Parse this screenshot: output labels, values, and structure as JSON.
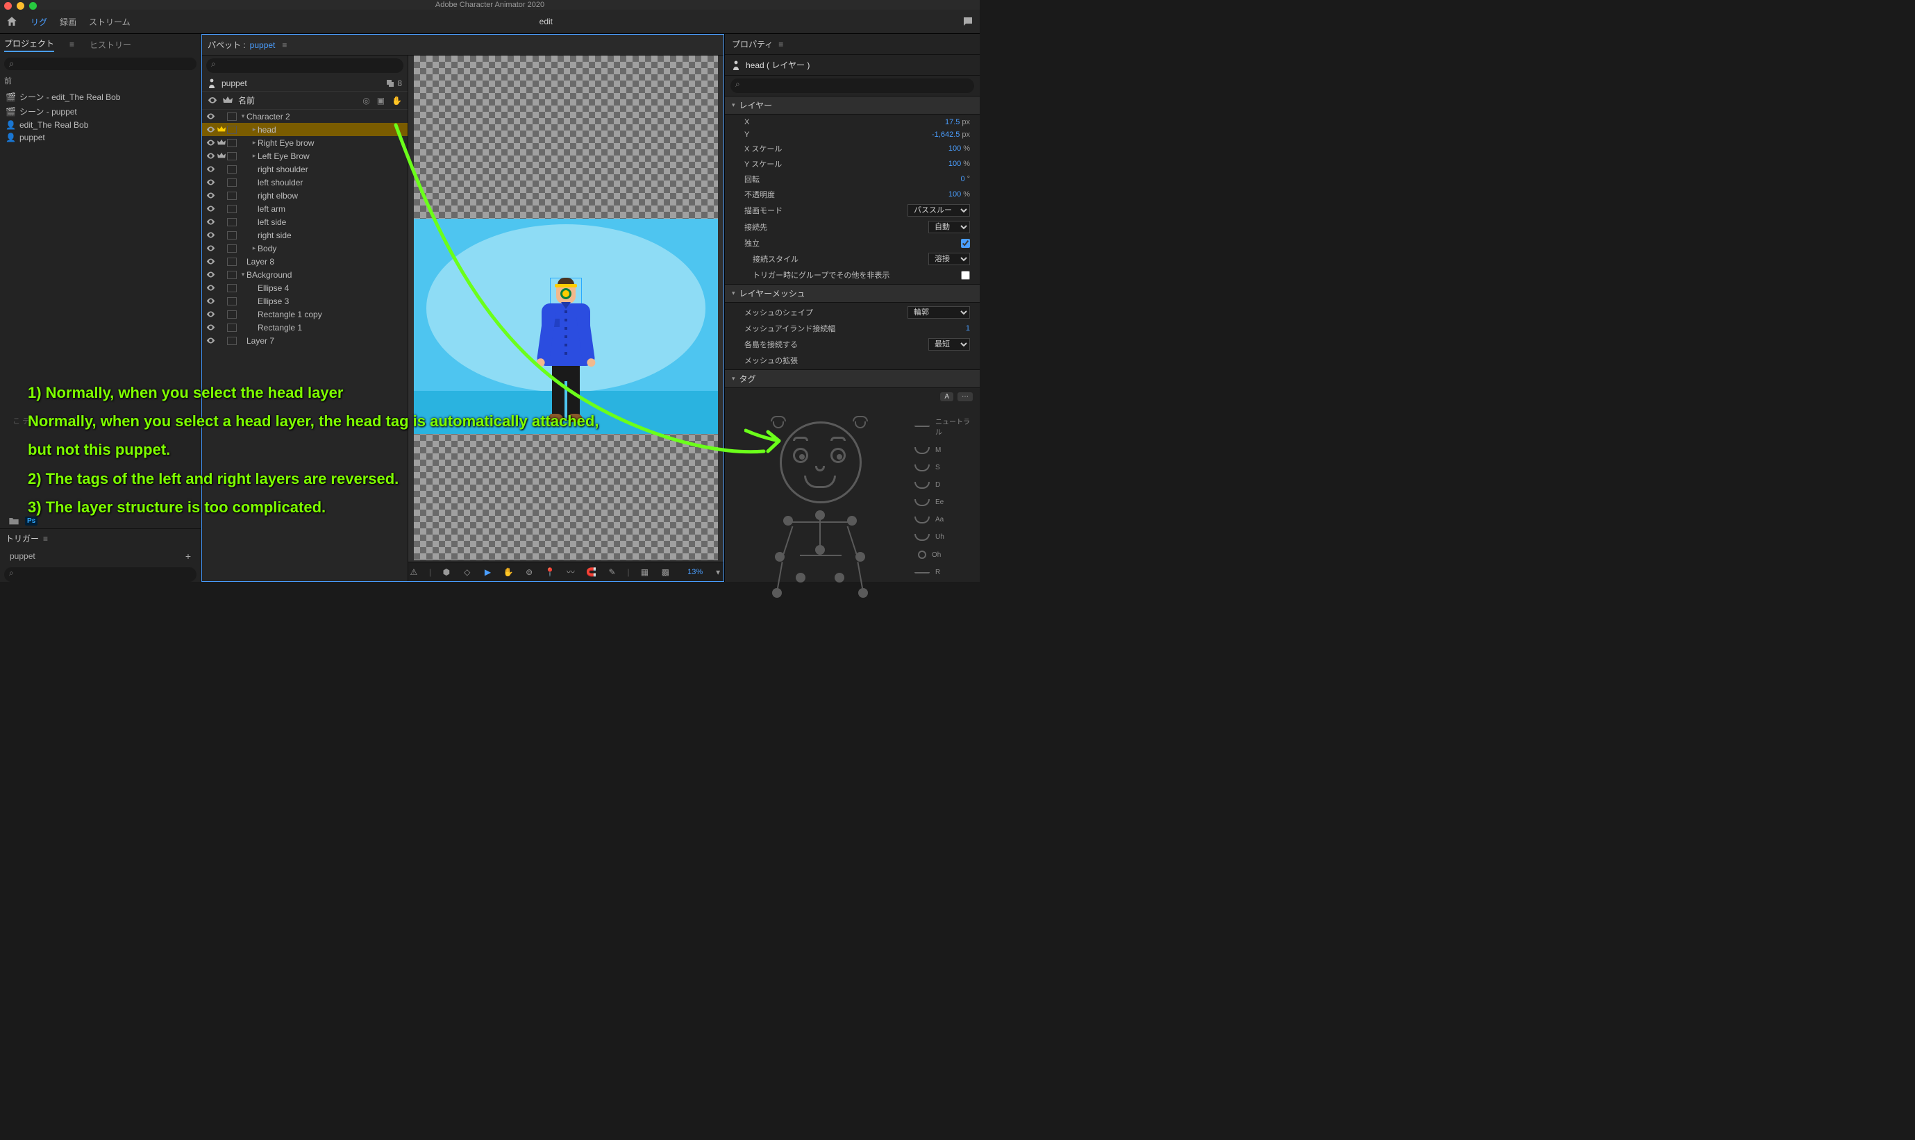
{
  "app_title": "Adobe Character Animator 2020",
  "menubar": {
    "rig": "リグ",
    "record": "録画",
    "stream": "ストリーム",
    "doc": "edit"
  },
  "left": {
    "tab_project": "プロジェクト",
    "tab_history": "ヒストリー",
    "header_prev": "前",
    "items": [
      {
        "icon": "scene",
        "label": "シーン - edit_The Real Bob"
      },
      {
        "icon": "scene",
        "label": "シーン - puppet"
      },
      {
        "icon": "puppet",
        "label": "edit_The Real Bob"
      },
      {
        "icon": "puppet",
        "label": "puppet"
      }
    ],
    "ps": "Ps",
    "trigger_title": "トリガー",
    "trigger_item": "puppet",
    "bottom_note": "こ\nディトピロス\n成"
  },
  "mid": {
    "panel_label": "パペット :",
    "panel_value": "puppet",
    "puppet_root": "puppet",
    "puppet_count": "8",
    "col_name": "名前",
    "rows": [
      {
        "depth": 0,
        "arrow": "v",
        "crown": false,
        "label": "Character 2"
      },
      {
        "depth": 1,
        "arrow": ">",
        "crown": true,
        "label": "head",
        "selected": true
      },
      {
        "depth": 1,
        "arrow": ">",
        "crown": true,
        "label": "Right Eye brow"
      },
      {
        "depth": 1,
        "arrow": ">",
        "crown": true,
        "label": "Left Eye Brow"
      },
      {
        "depth": 1,
        "arrow": "",
        "crown": false,
        "label": "right shoulder"
      },
      {
        "depth": 1,
        "arrow": "",
        "crown": false,
        "label": "left shoulder"
      },
      {
        "depth": 1,
        "arrow": "",
        "crown": false,
        "label": "right elbow"
      },
      {
        "depth": 1,
        "arrow": "",
        "crown": false,
        "label": "left arm"
      },
      {
        "depth": 1,
        "arrow": "",
        "crown": false,
        "label": "left side"
      },
      {
        "depth": 1,
        "arrow": "",
        "crown": false,
        "label": "right side"
      },
      {
        "depth": 1,
        "arrow": ">",
        "crown": false,
        "label": "Body"
      },
      {
        "depth": 0,
        "arrow": "",
        "crown": false,
        "label": "Layer 8"
      },
      {
        "depth": 0,
        "arrow": "v",
        "crown": false,
        "label": "BAckground"
      },
      {
        "depth": 1,
        "arrow": "",
        "crown": false,
        "label": "Ellipse 4"
      },
      {
        "depth": 1,
        "arrow": "",
        "crown": false,
        "label": "Ellipse 3"
      },
      {
        "depth": 1,
        "arrow": "",
        "crown": false,
        "label": "Rectangle 1 copy"
      },
      {
        "depth": 1,
        "arrow": "",
        "crown": false,
        "label": "Rectangle 1"
      },
      {
        "depth": 0,
        "arrow": "",
        "crown": false,
        "label": "Layer 7"
      }
    ],
    "zoom": "13%"
  },
  "right": {
    "panel": "プロパティ",
    "layer_title": "head ( レイヤー )",
    "sec_layer": "レイヤー",
    "props": {
      "x_k": "X",
      "x_v": "17.5",
      "x_u": "px",
      "y_k": "Y",
      "y_v": "-1,642.5",
      "y_u": "px",
      "sx_k": "X スケール",
      "sx_v": "100",
      "sx_u": "%",
      "sy_k": "Y スケール",
      "sy_v": "100",
      "sy_u": "%",
      "rot_k": "回転",
      "rot_v": "0",
      "rot_u": "°",
      "op_k": "不透明度",
      "op_v": "100",
      "op_u": "%",
      "draw_k": "描画モード",
      "draw_v": "パススルー",
      "attach_k": "接続先",
      "attach_v": "自動",
      "indep_k": "独立",
      "style_k": "接続スタイル",
      "style_v": "溶接",
      "hide_k": "トリガー時にグループでその他を非表示"
    },
    "sec_mesh": "レイヤーメッシュ",
    "mesh": {
      "shape_k": "メッシュのシェイプ",
      "shape_v": "輪郭",
      "island_k": "メッシュアイランド接続幅",
      "island_v": "1",
      "connect_k": "各島を接続する",
      "connect_v": "最短",
      "expand_k": "メッシュの拡張"
    },
    "sec_tag": "タグ",
    "tag_a": "A",
    "visemes": [
      {
        "shape": "closed",
        "label": "ニュートラル"
      },
      {
        "shape": "open",
        "label": "M"
      },
      {
        "shape": "open",
        "label": "S"
      },
      {
        "shape": "open",
        "label": "D"
      },
      {
        "shape": "open",
        "label": "Ee"
      },
      {
        "shape": "open",
        "label": "Aa"
      },
      {
        "shape": "open",
        "label": "Uh"
      },
      {
        "shape": "round",
        "label": "Oh"
      },
      {
        "shape": "closed",
        "label": "R"
      }
    ]
  },
  "annot": {
    "l1": "1) Normally, when you select the head layer",
    "l2": "Normally, when you select a head layer, the head tag is automatically attached,",
    "l3": "but not this puppet.",
    "l4": "2) The tags of the left and right layers are reversed.",
    "l5": "3) The layer structure is too complicated."
  }
}
